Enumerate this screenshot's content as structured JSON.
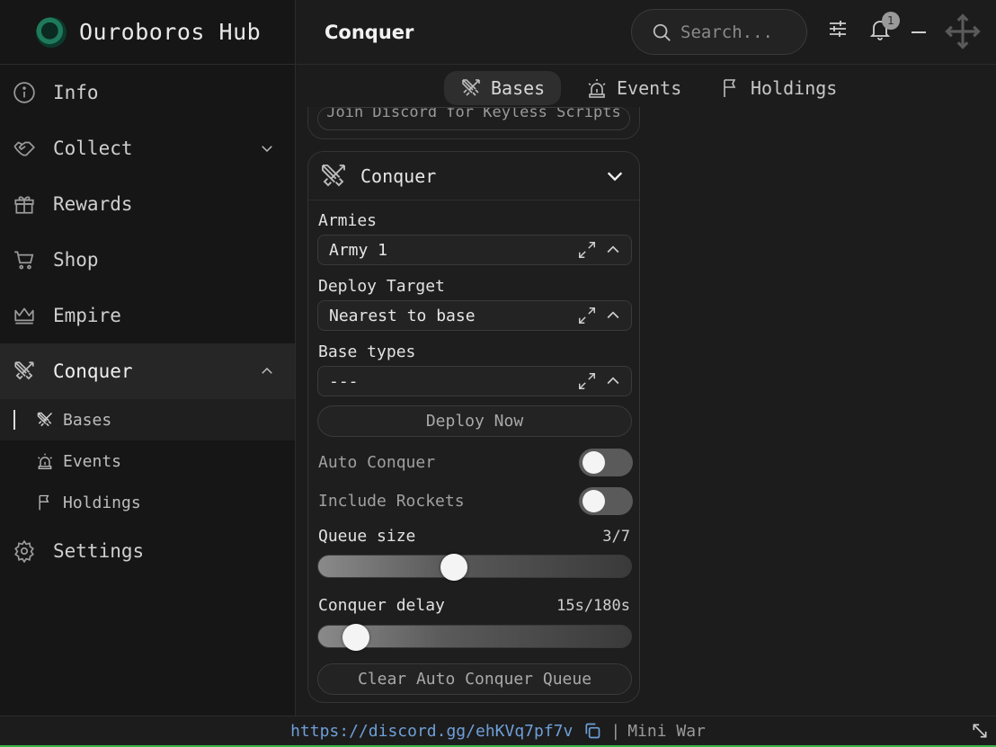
{
  "app": {
    "title": "Ouroboros Hub"
  },
  "header": {
    "title": "Conquer",
    "search_placeholder": "Search...",
    "notification_count": "1"
  },
  "sidebar": {
    "items": [
      {
        "label": "Info"
      },
      {
        "label": "Collect"
      },
      {
        "label": "Rewards"
      },
      {
        "label": "Shop"
      },
      {
        "label": "Empire"
      },
      {
        "label": "Conquer"
      },
      {
        "label": "Settings"
      }
    ],
    "sub_items": [
      {
        "label": "Bases"
      },
      {
        "label": "Events"
      },
      {
        "label": "Holdings"
      }
    ]
  },
  "tabs": [
    {
      "label": "Bases"
    },
    {
      "label": "Events"
    },
    {
      "label": "Holdings"
    }
  ],
  "prev_card": {
    "button_label": "Join Discord for Keyless Scripts"
  },
  "conquer_card": {
    "title": "Conquer",
    "armies": {
      "label": "Armies",
      "value": "Army 1"
    },
    "deploy_target": {
      "label": "Deploy Target",
      "value": "Nearest to base"
    },
    "base_types": {
      "label": "Base types",
      "value": "---"
    },
    "deploy_now": "Deploy Now",
    "auto_conquer": {
      "label": "Auto Conquer",
      "enabled": false
    },
    "include_rockets": {
      "label": "Include Rockets",
      "enabled": false
    },
    "queue_size": {
      "label": "Queue size",
      "display": "3/7",
      "value": 3,
      "max": 7
    },
    "conquer_delay": {
      "label": "Conquer delay",
      "display": "15s/180s",
      "value": 15,
      "max": 180
    },
    "clear_queue": "Clear Auto Conquer Queue"
  },
  "footer": {
    "link": "https://discord.gg/ehKVq7pf7v",
    "separator": "|",
    "game": "Mini War"
  },
  "colors": {
    "accent_border": "#3bb54a",
    "link": "#6e9fd8",
    "background": "#1c1c1c"
  }
}
